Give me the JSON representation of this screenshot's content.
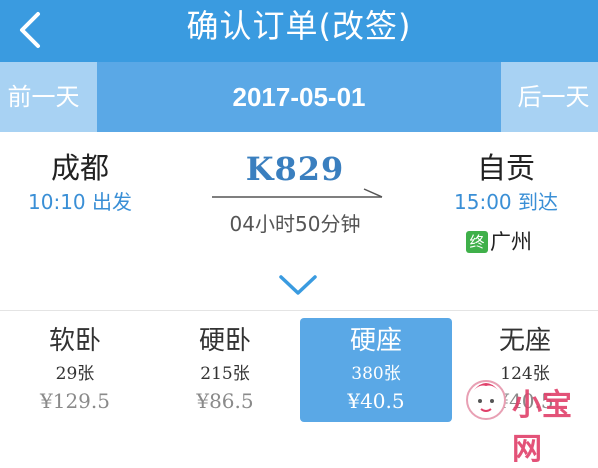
{
  "header": {
    "title": "确认订单(改签)",
    "back_icon": "chevron-left-icon"
  },
  "datebar": {
    "prev_label": "前一天",
    "date": "2017-05-01",
    "next_label": "后一天"
  },
  "trip": {
    "from": {
      "station": "成都",
      "time": "10:10 出发"
    },
    "train_number": "K829",
    "duration": "04小时50分钟",
    "to": {
      "station": "自贡",
      "time": "15:00 到达"
    },
    "terminal_badge": "终",
    "terminal": "广州",
    "expand_icon": "chevron-down-icon"
  },
  "seats": [
    {
      "name": "软卧",
      "count": "29张",
      "price": "¥129.5",
      "selected": false
    },
    {
      "name": "硬卧",
      "count": "215张",
      "price": "¥86.5",
      "selected": false
    },
    {
      "name": "硬座",
      "count": "380张",
      "price": "¥40.5",
      "selected": true
    },
    {
      "name": "无座",
      "count": "124张",
      "price": "¥40.5",
      "selected": false
    }
  ],
  "watermark": {
    "text": "小宝网"
  },
  "colors": {
    "accent": "#3a9be0",
    "selected": "#5aa8e6",
    "terminal_badge": "#3fb04a",
    "watermark": "#e0406a"
  }
}
